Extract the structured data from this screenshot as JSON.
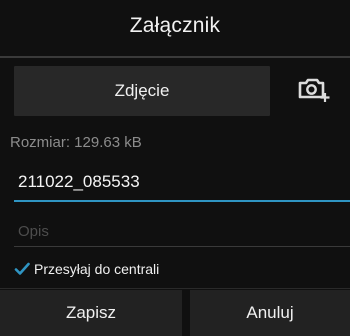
{
  "dialog": {
    "title": "Załącznik"
  },
  "photo": {
    "button_label": "Zdjęcie",
    "camera_icon": "camera-add-icon"
  },
  "file": {
    "size_text": "Rozmiar: 129.63 kB",
    "name_value": "211022_085533",
    "description_placeholder": "Opis"
  },
  "send_to_central": {
    "label": "Przesyłaj do centrali",
    "checked": true
  },
  "footer": {
    "save_label": "Zapisz",
    "cancel_label": "Anuluj"
  },
  "colors": {
    "background": "#101010",
    "accent": "#2f95c3",
    "button_bg": "#282828"
  }
}
